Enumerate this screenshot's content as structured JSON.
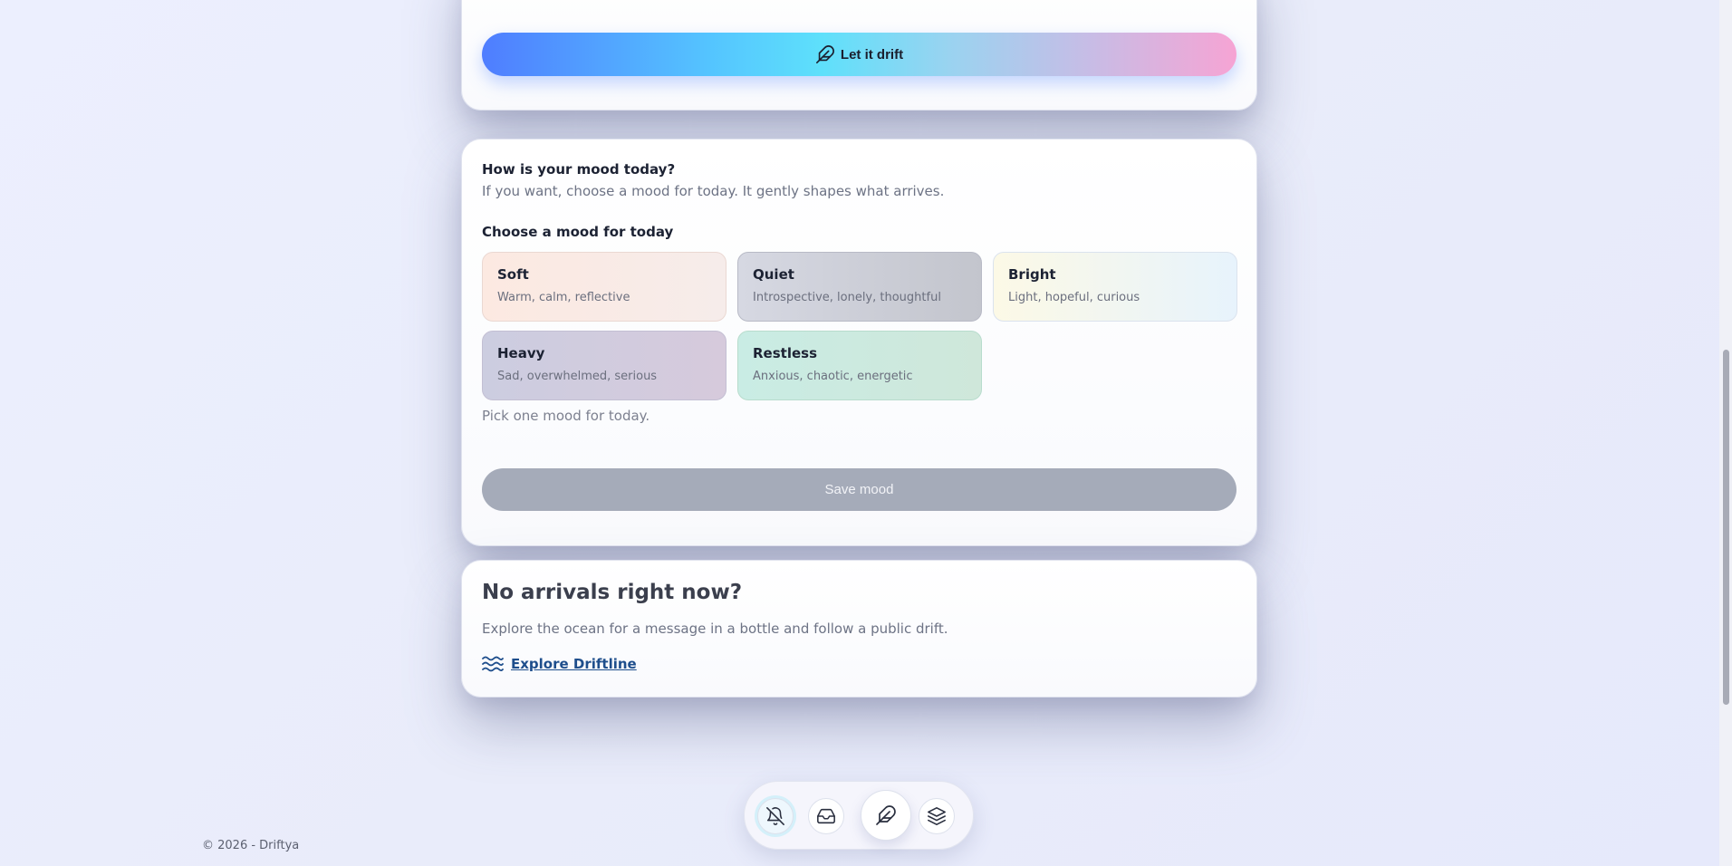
{
  "compose": {
    "drift_button_label": "Let it drift",
    "drift_icon": "feather-icon"
  },
  "mood": {
    "title": "How is your mood today?",
    "subtitle": "If you want, choose a mood for today. It gently shapes what arrives.",
    "choose_label": "Choose a mood for today",
    "options": [
      {
        "name": "Soft",
        "desc": "Warm, calm, reflective"
      },
      {
        "name": "Quiet",
        "desc": "Introspective, lonely, thoughtful"
      },
      {
        "name": "Bright",
        "desc": "Light, hopeful, curious"
      },
      {
        "name": "Heavy",
        "desc": "Sad, overwhelmed, serious"
      },
      {
        "name": "Restless",
        "desc": "Anxious, chaotic, energetic"
      }
    ],
    "hint": "Pick one mood for today.",
    "save_label": "Save mood"
  },
  "arrivals": {
    "title": "No arrivals right now?",
    "subtitle": "Explore the ocean for a message in a bottle and follow a public drift.",
    "link_label": "Explore Driftline",
    "link_icon": "waves-icon"
  },
  "footer": {
    "copyright": "© 2026 - Driftya"
  },
  "bottom_nav": {
    "items": [
      "bell-off-icon",
      "inbox-icon",
      "feather-icon",
      "layers-icon"
    ]
  },
  "colors": {
    "accent_start": "#4f7dff",
    "accent_end": "#f6a4d4",
    "link": "#1e4e8c",
    "save_disabled": "#a5abb9"
  }
}
